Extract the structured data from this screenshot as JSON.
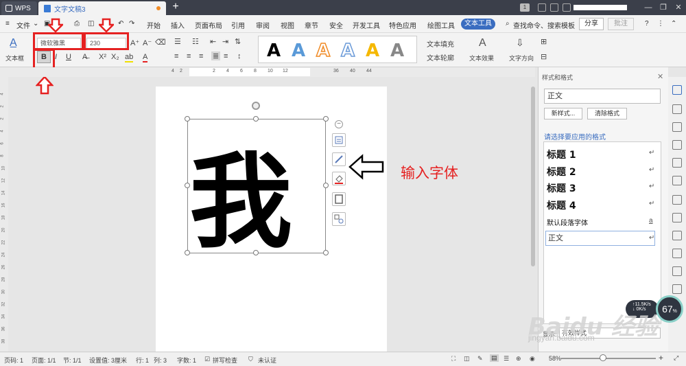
{
  "titlebar": {
    "app_name": "WPS",
    "doc_tab": "文字文稿3",
    "new_tab": "+",
    "badge": "1"
  },
  "menu": {
    "file": "文件",
    "items": [
      "开始",
      "插入",
      "页面布局",
      "引用",
      "审阅",
      "视图",
      "章节",
      "安全",
      "开发工具",
      "特色应用",
      "绘图工具"
    ],
    "active": "文本工具",
    "search": "查找命令、搜索模板",
    "share": "分享",
    "annotate": "批注"
  },
  "toolbar": {
    "font_name": "微软雅黑",
    "font_size": "230",
    "text_box": "文本框",
    "bold": "B",
    "text_fill": "文本填充",
    "text_outline": "文本轮廓",
    "text_effect": "文本效果",
    "text_direction": "文字方向"
  },
  "ruler": {
    "numbers": [
      "4",
      "2",
      "2",
      "4",
      "6",
      "8",
      "10",
      "12",
      "36",
      "40",
      "44"
    ]
  },
  "vruler": {
    "numbers": [
      "4",
      "2",
      "2",
      "4",
      "6",
      "8",
      "10",
      "12",
      "14",
      "16",
      "18",
      "20",
      "22",
      "24",
      "26",
      "28",
      "30",
      "32",
      "34",
      "36",
      "38"
    ]
  },
  "document": {
    "big_char": "我",
    "annotation": "输入字体"
  },
  "panel": {
    "title": "样式和格式",
    "current_style": "正文",
    "new_style": "新样式...",
    "clear_format": "清除格式",
    "hint": "请选择要应用的格式",
    "styles": [
      "标题 1",
      "标题 2",
      "标题 3",
      "标题 4"
    ],
    "default_font": "默认段落字体",
    "default_font_mark": "a",
    "selected": "正文",
    "show_label": "显示:",
    "show_value": "有效样式"
  },
  "speed": {
    "up": "↑11.5K/s",
    "down": "↓ 0K/s",
    "percent": "67"
  },
  "watermark": {
    "main": "Baidu 经验",
    "sub": "jingyan.baidu.com"
  },
  "status": {
    "page_code": "页码: 1",
    "pages": "页面: 1/1",
    "section": "节: 1/1",
    "setting": "设置值: 3厘米",
    "row": "行: 1",
    "col": "列: 3",
    "words": "字数: 1",
    "spell": "拼写检查",
    "cert": "未认证",
    "zoom": "58%",
    "zoom_minus": "-",
    "zoom_plus": "+"
  },
  "colors": {
    "accent": "#3a6dc0",
    "annotation_red": "#e52121",
    "titlebar": "#3b3f4a"
  }
}
